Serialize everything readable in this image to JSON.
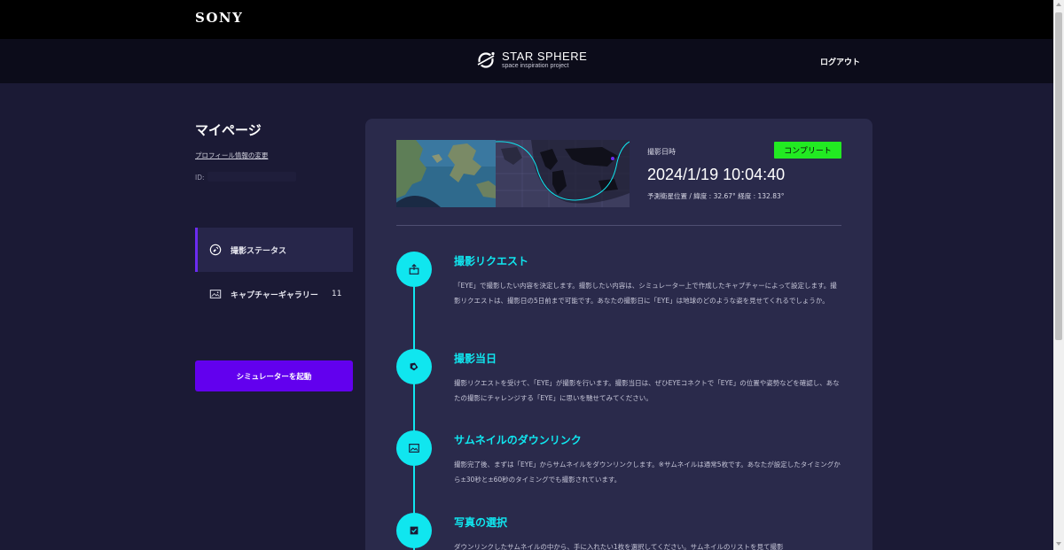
{
  "topbar": {
    "brand": "SONY"
  },
  "header": {
    "logo_title": "STAR SPHERE",
    "logo_subtitle": "space inspiration project",
    "logout_label": "ログアウト"
  },
  "sidebar": {
    "title": "マイページ",
    "profile_link": "プロフィール情報の変更",
    "id_label": "ID:",
    "nav": [
      {
        "label": "撮影ステータス",
        "icon": "satellite-icon",
        "active": true
      },
      {
        "label": "キャプチャーギャラリー",
        "icon": "gallery-icon",
        "count": "11"
      }
    ],
    "simulator_button": "シミュレーターを起動"
  },
  "capture": {
    "status_badge": "コンプリート",
    "datetime_label": "撮影日時",
    "datetime": "2024/1/19 10:04:40",
    "position": "予測衛星位置 / 緯度 : 32.67° 経度 : 132.83°",
    "colors": {
      "badge": "#22ea22",
      "accent": "#10e6ef",
      "button": "#6200ee"
    }
  },
  "steps": [
    {
      "icon": "request-icon",
      "title": "撮影リクエスト",
      "text": "「EYE」で撮影したい内容を決定します。撮影したい内容は、シミュレーター上で作成したキャプチャーによって設定します。撮影リクエストは、撮影日の5日前まで可能です。あなたの撮影日に「EYE」は地球のどのような姿を見せてくれるでしょうか。"
    },
    {
      "icon": "camera-shutter-icon",
      "title": "撮影当日",
      "text": "撮影リクエストを受けて、「EYE」が撮影を行います。撮影当日は、ぜひEYEコネクトで「EYE」の位置や姿勢などを確認し、あなたの撮影にチャレンジする「EYE」に思いを馳せてみてください。"
    },
    {
      "icon": "image-icon",
      "title": "サムネイルのダウンリンク",
      "text": "撮影完了後、まずは「EYE」からサムネイルをダウンリンクします。※サムネイルは通常5枚です。あなたが設定したタイミングから±30秒と±60秒のタイミングでも撮影されています。"
    },
    {
      "icon": "checkbox-icon",
      "title": "写真の選択",
      "text": "ダウンリンクしたサムネイルの中から、手に入れたい1枚を選択してください。サムネイルのリストを見て撮影"
    }
  ]
}
